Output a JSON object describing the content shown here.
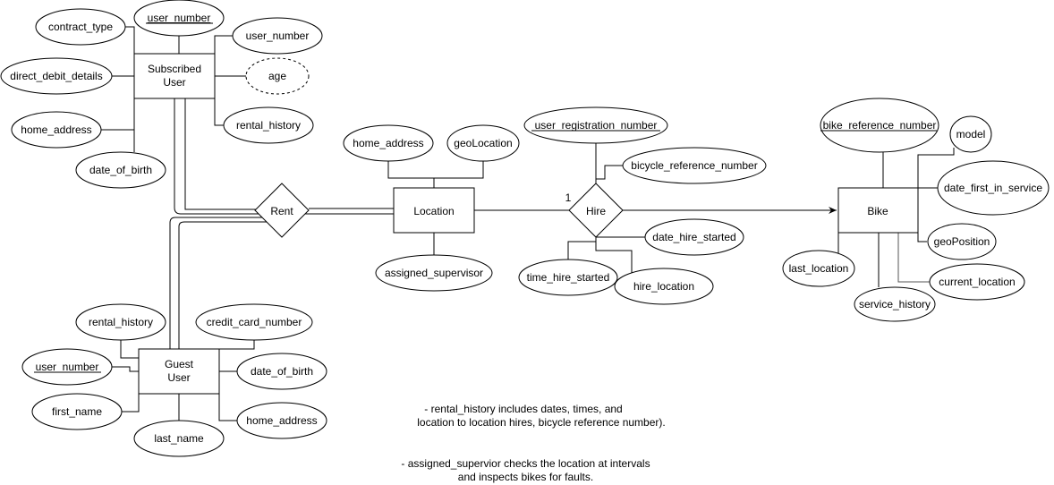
{
  "entities": {
    "subscribed_user": [
      "Subscribed",
      "User"
    ],
    "guest_user": [
      "Guest",
      "User"
    ],
    "location": "Location",
    "bike": "Bike"
  },
  "relationships": {
    "rent": "Rent",
    "hire": "Hire",
    "hire_cardinality": "1"
  },
  "attributes": {
    "subscribed_user": {
      "user_number_key": "user_number",
      "user_number": "user_number",
      "contract_type": "contract_type",
      "direct_debit_details": "direct_debit_details",
      "age": "age",
      "home_address": "home_address",
      "rental_history": "rental_history",
      "date_of_birth": "date_of_birth"
    },
    "location": {
      "home_address": "home_address",
      "geoLocation": "geoLocation",
      "assigned_supervisor": "assigned_supervisor"
    },
    "hire": {
      "user_registration_number": "user_registration_number",
      "bicycle_reference_number": "bicycle_reference_number",
      "date_hire_started": "date_hire_started",
      "time_hire_started": "time_hire_started",
      "hire_location": "hire_location"
    },
    "bike": {
      "bike_reference_number": "bike_reference_number",
      "model": "model",
      "date_first_in_service": "date_first_in_service",
      "geoPosition": "geoPosition",
      "last_location": "last_location",
      "current_location": "current_location",
      "service_history": "service_history"
    },
    "guest_user": {
      "rental_history": "rental_history",
      "credit_card_number": "credit_card_number",
      "user_number": "user_number",
      "date_of_birth": "date_of_birth",
      "first_name": "first_name",
      "home_address": "home_address",
      "last_name": "last_name"
    }
  },
  "notes": {
    "rental_history_line1": "- rental_history includes dates, times, and",
    "rental_history_line2": "location to location hires, bicycle reference number).",
    "supervisor_line1": "- assigned_supervior checks the location at intervals",
    "supervisor_line2": "and inspects bikes for faults."
  }
}
